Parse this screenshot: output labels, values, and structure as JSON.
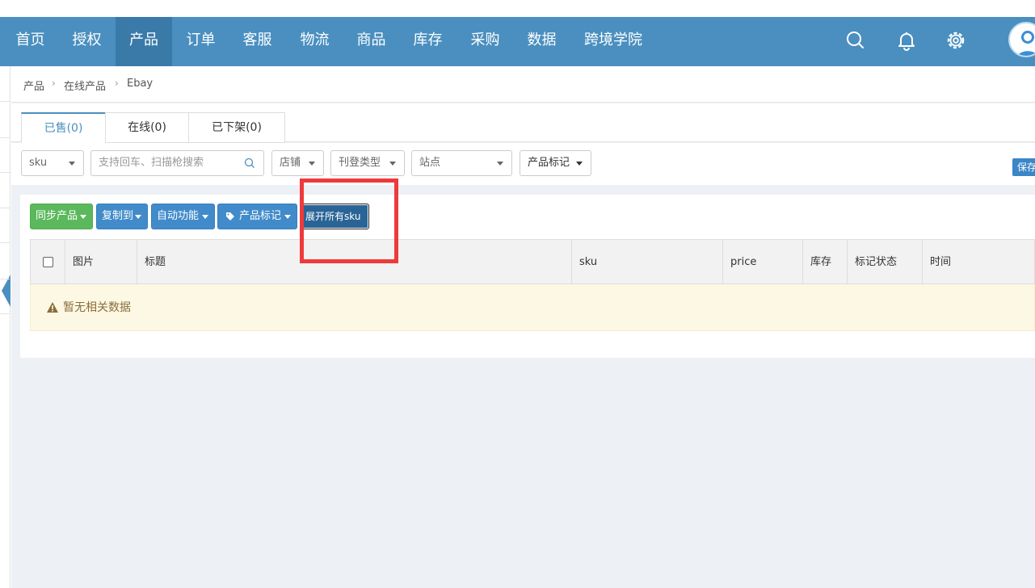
{
  "nav": {
    "items": [
      "首页",
      "授权",
      "产品",
      "订单",
      "客服",
      "物流",
      "商品",
      "库存",
      "采购",
      "数据",
      "跨境学院"
    ],
    "active_index": 2,
    "icons": [
      "search-icon",
      "bell-icon",
      "gear-icon",
      "user-avatar"
    ]
  },
  "breadcrumb": [
    "产品",
    "在线产品",
    "Ebay"
  ],
  "tabs": [
    "已售(0)",
    "在线(0)",
    "已下架(0)"
  ],
  "filters": {
    "sku_select": "sku",
    "search_placeholder": "支持回车、扫描枪搜索",
    "store_select": "店铺",
    "listing_type_select": "刊登类型",
    "site_select": "站点",
    "product_mark_select": "产品标记",
    "save_label": "保存"
  },
  "toolbar": {
    "sync_label": "同步产品",
    "copy_label": "复制到",
    "auto_label": "自动功能",
    "mark_label": "产品标记",
    "expand_label": "展开所有sku"
  },
  "table": {
    "columns": [
      "图片",
      "标题",
      "sku",
      "price",
      "库存",
      "标记状态",
      "时间"
    ],
    "empty_text": "暂无相关数据"
  },
  "colors": {
    "topbar": "#4a8fbf",
    "highlight_box": "#ee3a3a",
    "green_button": "#5cb85c",
    "blue_button": "#428bca"
  }
}
